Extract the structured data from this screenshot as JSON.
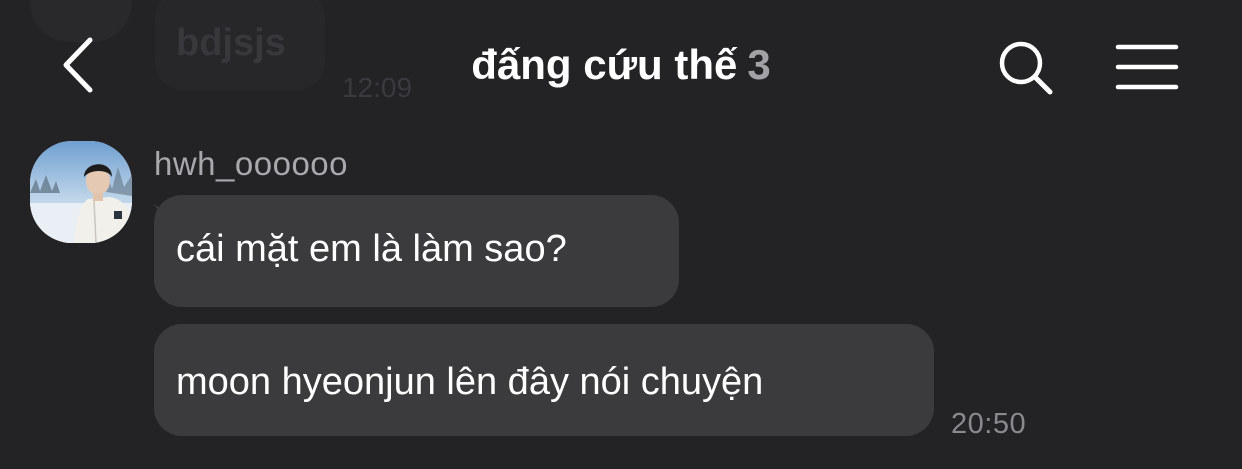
{
  "background_header": {
    "ghost_text": "bdjsjs",
    "ghost_time": "12:09"
  },
  "header": {
    "title": "đấng cứu thế",
    "member_count": "3"
  },
  "icons": {
    "back": "chevron-left-icon",
    "search": "search-icon",
    "menu": "hamburger-menu-icon"
  },
  "message_group": {
    "sender": "hwh_oooooo",
    "messages": [
      {
        "text": "cái mặt em là làm sao?"
      },
      {
        "text": "moon hyeonjun lên đây nói chuyện"
      }
    ],
    "timestamp": "20:50"
  },
  "colors": {
    "background": "#232325",
    "bubble": "#3b3b3e",
    "secondary_text": "#a9a9ad",
    "timestamp": "#8a8a8e"
  }
}
